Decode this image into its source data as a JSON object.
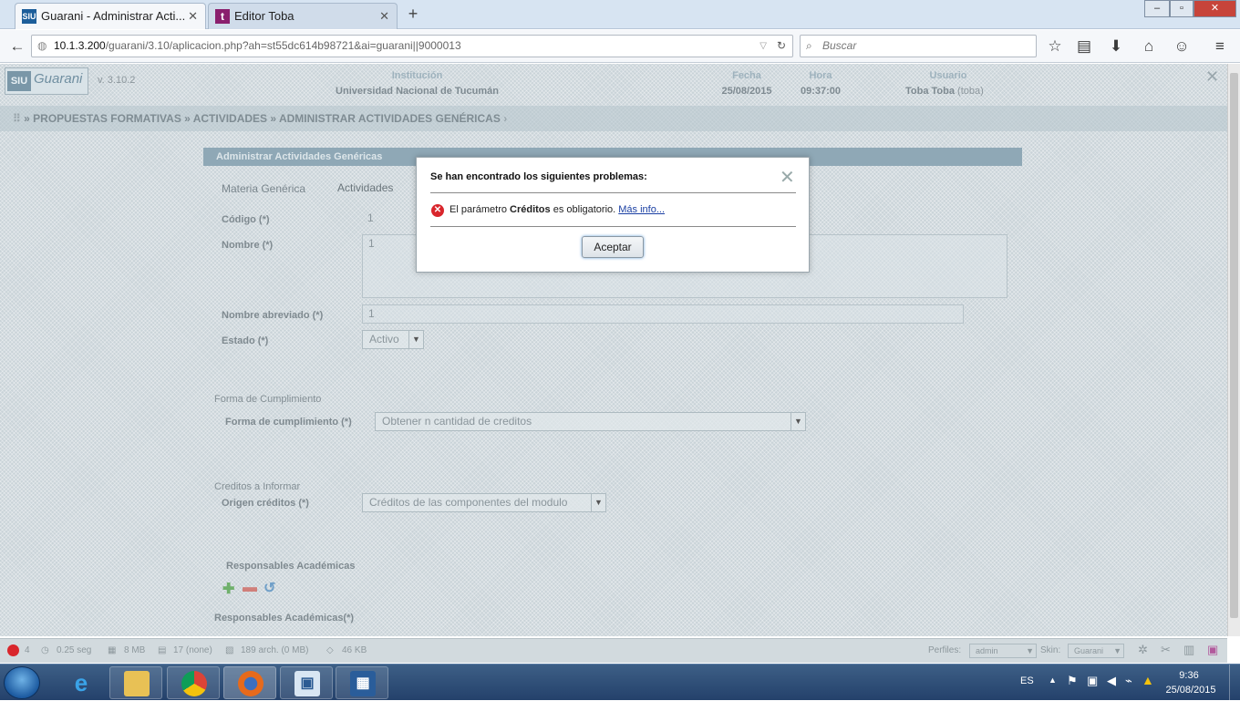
{
  "browser": {
    "tabs": [
      {
        "title": "Guarani - Administrar Acti...",
        "favicon": "SIU",
        "active": true
      },
      {
        "title": "Editor Toba",
        "favicon": "t",
        "active": false
      }
    ],
    "new_tab_label": "+",
    "url_host": "10.1.3.200",
    "url_path": "/guarani/3.10/aplicacion.php?ah=st55dc614b98721&ai=guarani||9000013",
    "search_placeholder": "Buscar"
  },
  "header": {
    "logo_siu": "SIU",
    "logo_name": "Guarani",
    "version": "v. 3.10.2",
    "institution_label": "Institución",
    "institution": "Universidad Nacional de Tucumán",
    "date_label": "Fecha",
    "date": "25/08/2015",
    "time_label": "Hora",
    "time": "09:37:00",
    "user_label": "Usuario",
    "user": "Toba Toba",
    "user_login": "(toba)"
  },
  "breadcrumb": "» PROPUESTAS FORMATIVAS » ACTIVIDADES » ADMINISTRAR ACTIVIDADES GENÉRICAS",
  "panel": {
    "title": "Administrar Actividades Genéricas",
    "tabs": [
      "Materia Genérica",
      "Actividades"
    ],
    "fields": {
      "codigo_label": "Código (*)",
      "codigo_value": "1",
      "nombre_label": "Nombre (*)",
      "nombre_value": "1",
      "nombre_abreviado_label": "Nombre abreviado (*)",
      "nombre_abreviado_value": "1",
      "estado_label": "Estado (*)",
      "estado_value": "Activo"
    },
    "forma_section": "Forma de Cumplimiento",
    "forma_label": "Forma de cumplimiento (*)",
    "forma_value": "Obtener n cantidad de creditos",
    "creditos_section": "Creditos a Informar",
    "origen_label": "Origen créditos (*)",
    "origen_value": "Créditos de las componentes del modulo",
    "responsables_title": "Responsables Académicas",
    "responsables_label": "Responsables Académicas(*)"
  },
  "modal": {
    "title": "Se han encontrado los siguientes problemas:",
    "close": "✕",
    "message_pre": "El parámetro ",
    "message_bold": "Créditos",
    "message_post": " es obligatorio. ",
    "more_info": "Más info...",
    "ok_label": "Aceptar"
  },
  "statusbar": {
    "errors": "4",
    "time": "0.25 seg",
    "memory": "8 MB",
    "queries": "17 (none)",
    "files": "189 arch. (0 MB)",
    "size": "46 KB",
    "perfiles_label": "Perfiles:",
    "perfiles_value": "admin",
    "skin_label": "Skin:",
    "skin_value": "Guarani"
  },
  "taskbar": {
    "language": "ES",
    "clock_time": "9:36",
    "clock_date": "25/08/2015"
  },
  "colors": {
    "error": "#d9262c",
    "link": "#1a3fa3",
    "taskbar": "#24416b"
  }
}
